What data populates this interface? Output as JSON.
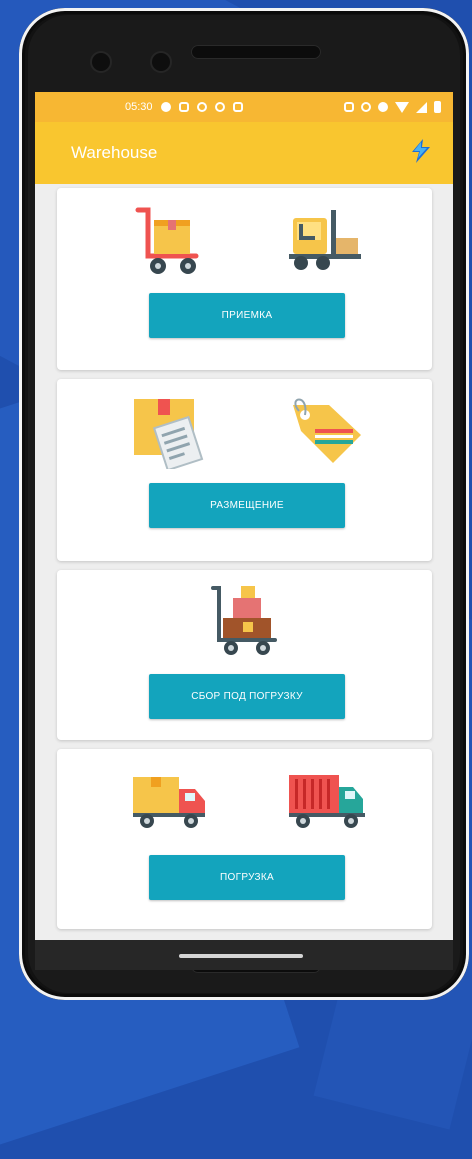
{
  "status_bar": {
    "time": "05:30",
    "color": "#f7b733"
  },
  "app_bar": {
    "title": "Warehouse",
    "logo_icon": "lightning-logo-icon",
    "color": "#f9c62f"
  },
  "cards": [
    {
      "button_label": "ПРИЕМКА",
      "icons": [
        "hand-truck-boxes-icon",
        "forklift-icon"
      ]
    },
    {
      "button_label": "РАЗМЕЩЕНИЕ",
      "icons": [
        "box-document-icon",
        "price-tag-icon"
      ]
    },
    {
      "button_label": "СБОР ПОД ПОГРУЗКУ",
      "icons": [
        "cart-with-boxes-icon"
      ]
    },
    {
      "button_label": "ПОГРУЗКА",
      "icons": [
        "delivery-van-icon",
        "cargo-truck-icon"
      ]
    }
  ],
  "colors": {
    "button": "#13a4bd",
    "background": "#1f4fae"
  }
}
